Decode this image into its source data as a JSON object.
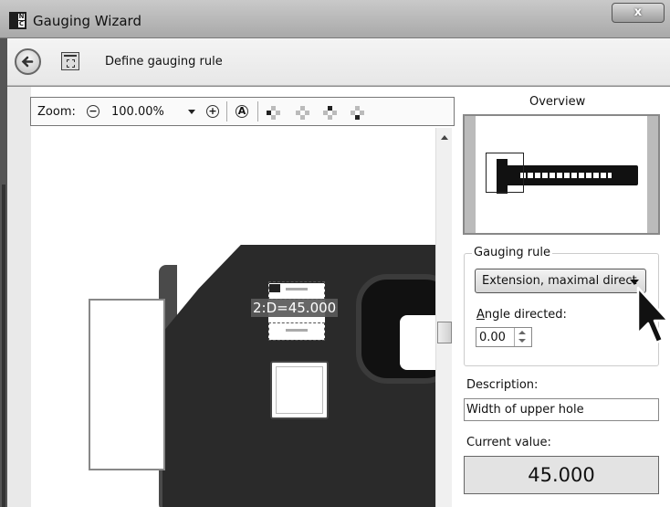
{
  "window": {
    "title": "Gauging Wizard",
    "close_label": "x",
    "app_icon_letters": [
      "N",
      "C"
    ]
  },
  "header": {
    "title": "Define gauging rule"
  },
  "toolbar": {
    "zoom_label": "Zoom:",
    "zoom_value": "100.00%"
  },
  "image": {
    "measure_label": "2:D=45.000"
  },
  "overview": {
    "label": "Overview"
  },
  "gauging_rule": {
    "legend": "Gauging rule",
    "selected": "Extension, maximal direct",
    "angle_label_prefix": "A",
    "angle_label_rest": "ngle directed:",
    "angle_value": "0.00"
  },
  "description": {
    "label": "Description:",
    "value": "Width of upper hole"
  },
  "current": {
    "label": "Current value:",
    "value": "45.000"
  },
  "colors": {
    "titlebar": "#b5b5b5",
    "part": "#2a2a2a",
    "value_box": "#e3e3e3"
  }
}
